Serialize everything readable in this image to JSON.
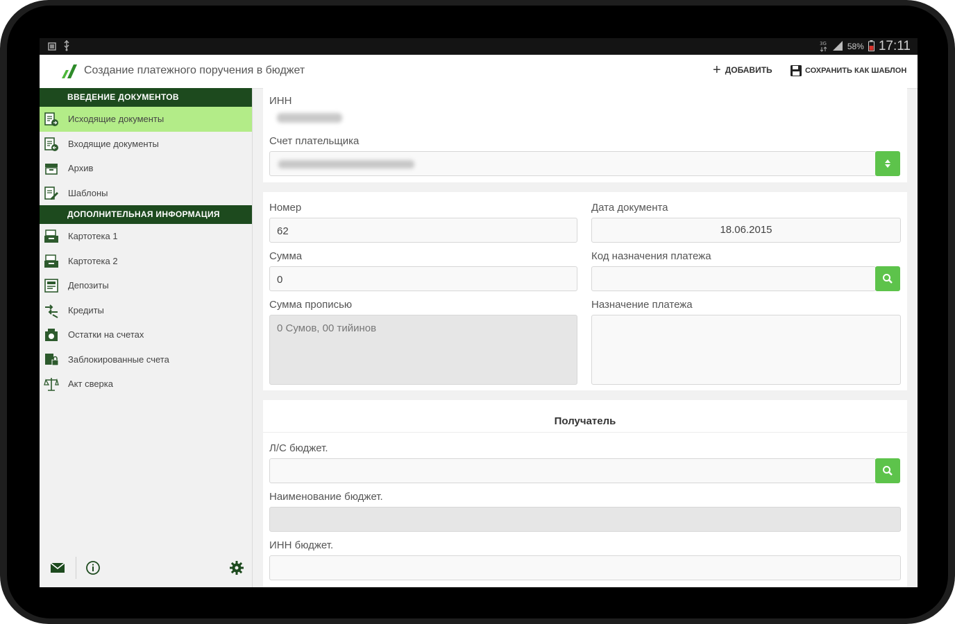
{
  "status_bar": {
    "battery": "58%",
    "time": "17:11"
  },
  "app_bar": {
    "title": "Создание платежного поручения в бюджет",
    "add_label": "ДОБАВИТЬ",
    "save_template_label": "СОХРАНИТЬ КАК ШАБЛОН"
  },
  "sidebar": {
    "section1": "ВВЕДЕНИЕ ДОКУМЕНТОВ",
    "items1": [
      {
        "label": "Исходящие документы",
        "icon": "outgoing-docs-icon"
      },
      {
        "label": "Входящие документы",
        "icon": "incoming-docs-icon"
      },
      {
        "label": "Архив",
        "icon": "archive-icon"
      },
      {
        "label": "Шаблоны",
        "icon": "templates-icon"
      }
    ],
    "section2": "ДОПОЛНИТЕЛЬНАЯ ИНФОРМАЦИЯ",
    "items2": [
      {
        "label": "Картотека 1",
        "icon": "card-index-icon"
      },
      {
        "label": "Картотека 2",
        "icon": "card-index-icon"
      },
      {
        "label": "Депозиты",
        "icon": "deposits-icon"
      },
      {
        "label": "Кредиты",
        "icon": "credits-icon"
      },
      {
        "label": "Остатки на счетах",
        "icon": "balances-icon"
      },
      {
        "label": "Заблокированные счета",
        "icon": "blocked-accounts-icon"
      },
      {
        "label": "Акт сверка",
        "icon": "reconciliation-icon"
      }
    ],
    "active_item": "Исходящие документы"
  },
  "form": {
    "inn_label": "ИНН",
    "payer_account_label": "Счет плательщика",
    "number_label": "Номер",
    "number_value": "62",
    "doc_date_label": "Дата документа",
    "doc_date_value": "18.06.2015",
    "sum_label": "Сумма",
    "sum_value": "0",
    "purpose_code_label": "Код назначения платежа",
    "sum_words_label": "Сумма прописью",
    "sum_words_value": "0 Сумов, 00 тийинов",
    "purpose_label": "Назначение платежа"
  },
  "recipient": {
    "title": "Получатель",
    "budget_account_label": "Л/С бюджет.",
    "budget_name_label": "Наименование бюджет.",
    "budget_inn_label": "ИНН бюджет."
  },
  "colors": {
    "accent": "#5dc34b",
    "section_header": "#1d4a1e",
    "active_item": "#b3ec88"
  }
}
